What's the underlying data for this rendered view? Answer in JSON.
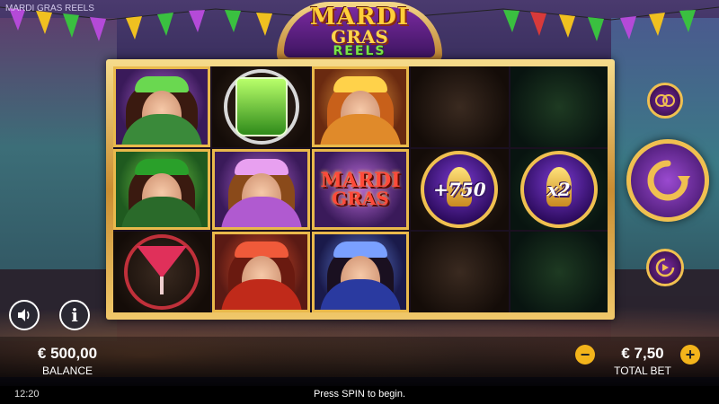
{
  "app": {
    "window_title": "MARDI GRAS REELS",
    "logo": {
      "line1": "MARDI",
      "line2": "GRAS",
      "line3": "REELS"
    }
  },
  "reels": {
    "col1": [
      "masked-ladies-trio",
      "green-dancer",
      "red-cocktail"
    ],
    "col2": [
      "green-mojito",
      "purple-dancer",
      "red-feather-dancer"
    ],
    "col3": [
      "orange-dancer",
      "mardi-gras-logo",
      "blue-dancer"
    ],
    "col4": [
      "empty",
      "bonus-coin-750",
      "empty"
    ],
    "col5": [
      "empty",
      "multiplier-coin-x2",
      "empty"
    ],
    "mardi_gras_symbol": {
      "line1": "MARDI",
      "line2": "GRAS"
    },
    "bonus_coin_label": "+750",
    "multiplier_label": "x2"
  },
  "controls": {
    "gamble_icon": "masks-icon",
    "spin_icon": "spin-arrow-icon",
    "autoplay_icon": "autoplay-icon",
    "sound_icon": "speaker-icon",
    "info_label": "i"
  },
  "footer": {
    "balance_value": "€ 500,00",
    "balance_label": "BALANCE",
    "bet_value": "€ 7,50",
    "bet_label": "TOTAL BET",
    "minus": "−",
    "plus": "+"
  },
  "status": {
    "clock": "12:20",
    "message": "Press SPIN to begin."
  },
  "colors": {
    "gold": "#f0c050",
    "purple": "#7a2aa0",
    "bet_button": "#f3b41b"
  }
}
